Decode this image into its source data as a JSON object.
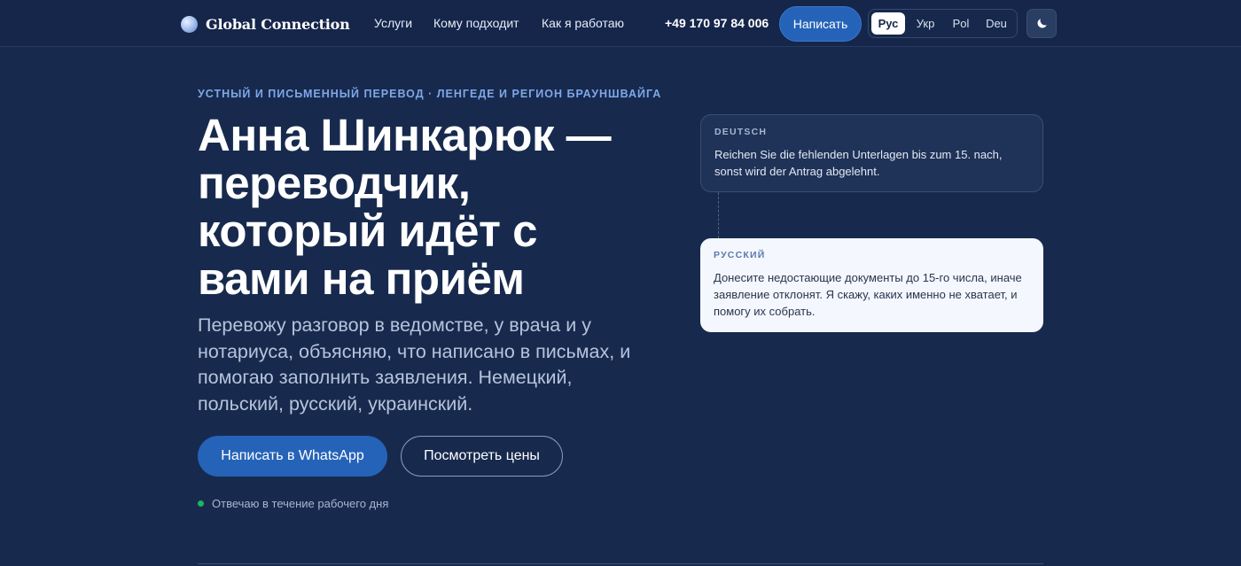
{
  "header": {
    "logo_text": "Global Connection",
    "nav": [
      "Услуги",
      "Кому подходит",
      "Как я работаю"
    ],
    "phone": "+49 170 97 84 006",
    "cta_label": "Написать",
    "languages": [
      "Рус",
      "Укр",
      "Pol",
      "Deu"
    ],
    "active_language": "Рус",
    "theme_icon": "moon-icon"
  },
  "hero": {
    "eyebrow": "УСТНЫЙ И ПИСЬМЕННЫЙ ПЕРЕВОД · ЛЕНГЕДЕ И РЕГИОН БРАУНШВАЙГА",
    "headline": "Анна Шинкарюк — переводчик, который идёт с вами на приём",
    "lead": "Перевожу разговор в ведомстве, у врача и у нотариуса, объясняю, что написано в письмах, и помогаю заполнить заявления. Немецкий, польский, русский, украинский.",
    "primary_button": "Написать в WhatsApp",
    "secondary_button": "Посмотреть цены",
    "status_text": "Отвечаю в течение рабочего дня"
  },
  "cards": {
    "source": {
      "label": "DEUTSCH",
      "text": "Reichen Sie die fehlenden Unterlagen bis zum 15. nach, sonst wird der Antrag abgelehnt."
    },
    "translation": {
      "label": "РУССКИЙ",
      "text": "Донесите недостающие документы до 15-го числа, иначе заявление отклонят. Я скажу, каких именно не хватает, и помогу их собрать."
    }
  },
  "colors": {
    "background": "#172a4e",
    "accent": "#2563b8",
    "eyebrow": "#7fa7e8",
    "status_dot": "#22b35e"
  }
}
